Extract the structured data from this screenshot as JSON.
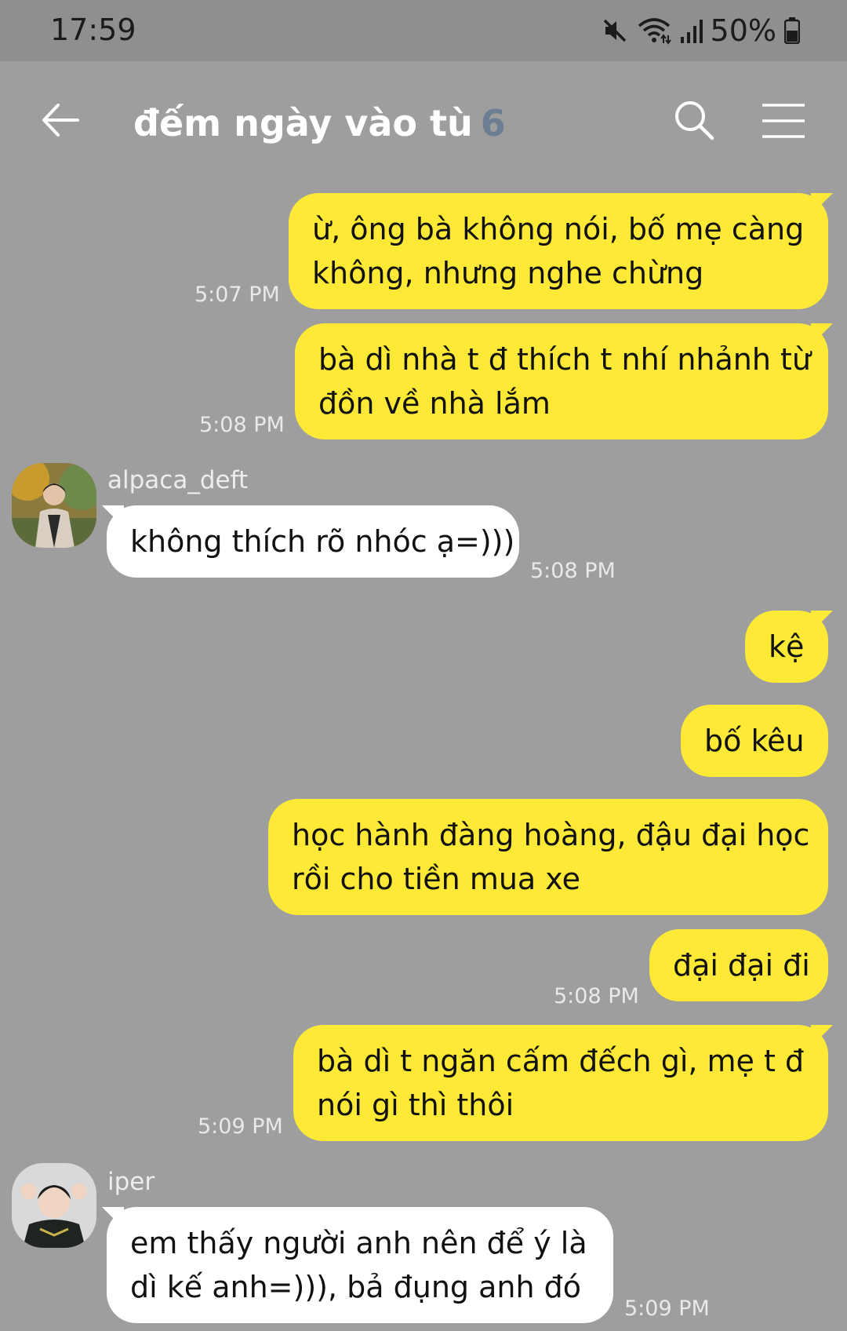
{
  "status_bar": {
    "time": "17:59",
    "battery": "50%",
    "icons": [
      "mute-icon",
      "wifi-icon",
      "signal-icon",
      "battery-icon"
    ]
  },
  "header": {
    "title": "đếm ngày vào tù",
    "member_count": "6",
    "icons": [
      "back-arrow-icon",
      "search-icon",
      "menu-icon"
    ]
  },
  "messages": [
    {
      "sender": "me",
      "lines": [
        "ừ, ông bà không nói, bố mẹ càng",
        "không, nhưng nghe chừng"
      ],
      "time": "5:07 PM"
    },
    {
      "sender": "me",
      "lines": [
        "bà dì nhà t đ thích t nhí nhảnh từ",
        "đồn về nhà lắm"
      ],
      "time": "5:08 PM"
    },
    {
      "sender": "alpaca_deft",
      "lines": [
        "không thích rõ nhóc ạ=)))"
      ],
      "time": "5:08 PM"
    },
    {
      "sender": "me",
      "lines": [
        "kệ"
      ],
      "time": ""
    },
    {
      "sender": "me",
      "lines": [
        "bố kêu"
      ],
      "time": ""
    },
    {
      "sender": "me",
      "lines": [
        "học hành đàng hoàng, đậu đại học",
        "rồi cho tiền mua xe"
      ],
      "time": ""
    },
    {
      "sender": "me",
      "lines": [
        "đại đại đi"
      ],
      "time": "5:08 PM"
    },
    {
      "sender": "me",
      "lines": [
        "bà dì t ngăn cấm đếch gì, mẹ t đ",
        "nói gì thì thôi"
      ],
      "time": "5:09 PM"
    },
    {
      "sender": "iper",
      "lines": [
        "em thấy người anh nên để ý là",
        "dì kế anh=))), bả đụng anh đó"
      ],
      "time": "5:09 PM"
    }
  ],
  "colors": {
    "background": "#9e9e9e",
    "my_bubble": "#fde936",
    "their_bubble": "#ffffff",
    "member_count": "#6d7e93"
  }
}
